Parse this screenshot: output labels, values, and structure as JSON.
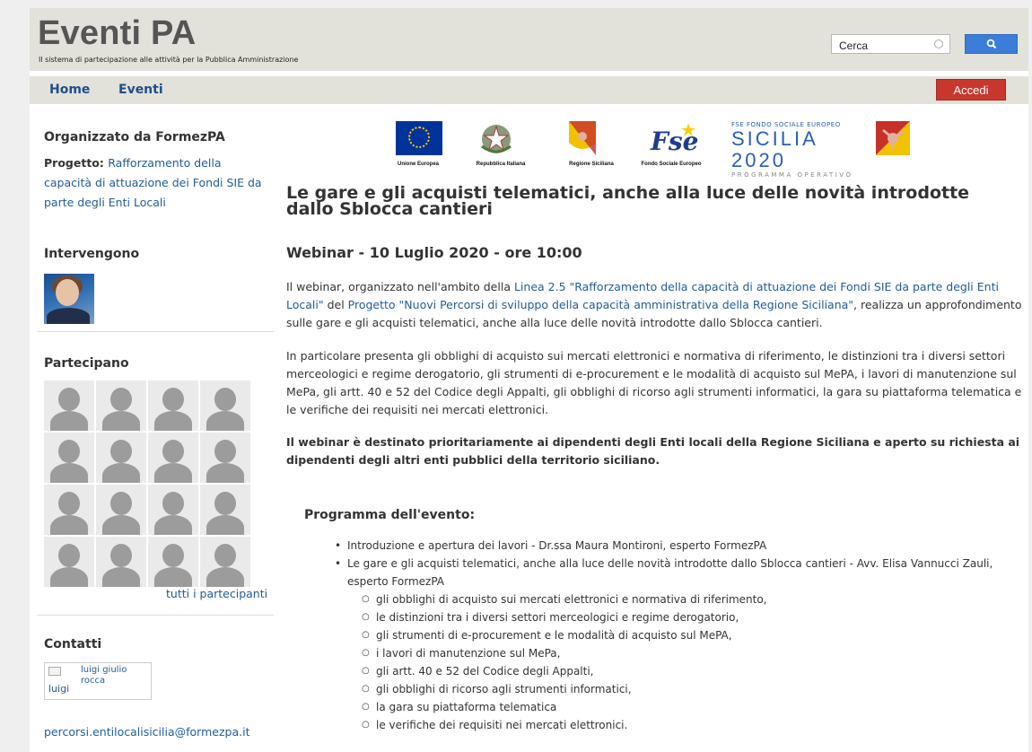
{
  "header": {
    "title": "Eventi PA",
    "tagline": "Il sistema di partecipazione alle attività per la Pubblica Amministrazione",
    "search_value": "Cerca"
  },
  "nav": {
    "home": "Home",
    "events": "Eventi",
    "login": "Accedi"
  },
  "sidebar": {
    "organized_heading": "Organizzato da FormezPA",
    "project_label": "Progetto",
    "project_link": "Rafforzamento della capacità di attuazione dei Fondi SIE da parte degli Enti Locali",
    "speakers_heading": "Intervengono",
    "participants_heading": "Partecipano",
    "all_participants": "tutti i partecipanti",
    "contacts_heading": "Contatti",
    "contact_alt": "luigi",
    "contact_name": "luigi giulio rocca",
    "email": "percorsi.entilocalisicilia@formezpa.it"
  },
  "logos": {
    "eu": "Unione Europea",
    "it": "Repubblica Italiana",
    "region": "Regione Siciliana",
    "fse": "Fondo Sociale Europeo",
    "sicilia_line1": "FSE FONDO SOCIALE EUROPEO",
    "sicilia_line2": "SICILIA 2020",
    "sicilia_line3": "PROGRAMMA OPERATIVO"
  },
  "main": {
    "title": "Le gare e gli acquisti telematici, anche alla luce delle novità introdotte dallo Sblocca cantieri",
    "subtitle": "Webinar - 10 Luglio 2020 - ore 10:00",
    "p1_a": "Il webinar, organizzato nell'ambito della ",
    "p1_link1": "Linea 2.5 \"Rafforzamento della capacità di attuazione dei Fondi SIE da parte degli Enti Locali\"",
    "p1_b": " del ",
    "p1_link2": "Progetto \"Nuovi Percorsi di sviluppo della capacità amministrativa della Regione Siciliana\"",
    "p1_c": ", realizza un approfondimento sulle gare e gli acquisti telematici, anche alla luce delle novità introdotte dallo Sblocca cantieri.",
    "p2": "In particolare presenta gli obblighi di acquisto sui mercati elettronici e normativa di riferimento, le distinzioni tra i diversi settori merceologici e regime derogatorio, gli strumenti di e-procurement e le modalità di acquisto sul MePA, i lavori di manutenzione sul MePa, gli artt. 40 e 52 del Codice degli Appalti, gli obblighi di ricorso agli strumenti informatici, la gara su piattaforma telematica e le verifiche dei requisiti nei mercati elettronici.",
    "p3": "Il webinar è destinato prioritariamente ai dipendenti degli Enti locali della Regione Siciliana e aperto su richiesta ai dipendenti degli altri enti pubblici della territorio siciliano.",
    "program_heading": "Programma dell'evento:",
    "program_items": [
      "Introduzione e apertura dei lavori - Dr.ssa Maura Montironi,  esperto FormezPA",
      "Le gare e gli acquisti telematici, anche alla luce delle novità introdotte dallo Sblocca cantieri - Avv. Elisa Vannucci Zauli, esperto FormezPA"
    ],
    "program_subitems": [
      "gli obblighi di acquisto sui mercati elettronici e normativa di riferimento,",
      "le distinzioni tra i diversi settori merceologici e regime derogatorio,",
      "gli strumenti di e-procurement e le modalità di acquisto sul MePA,",
      "i lavori di manutenzione sul MePa,",
      "gli artt. 40 e 52 del Codice degli Appalti,",
      "gli obblighi di ricorso agli strumenti informatici,",
      "la gara su piattaforma telematica",
      "le verifiche dei requisiti nei mercati elettronici."
    ]
  }
}
